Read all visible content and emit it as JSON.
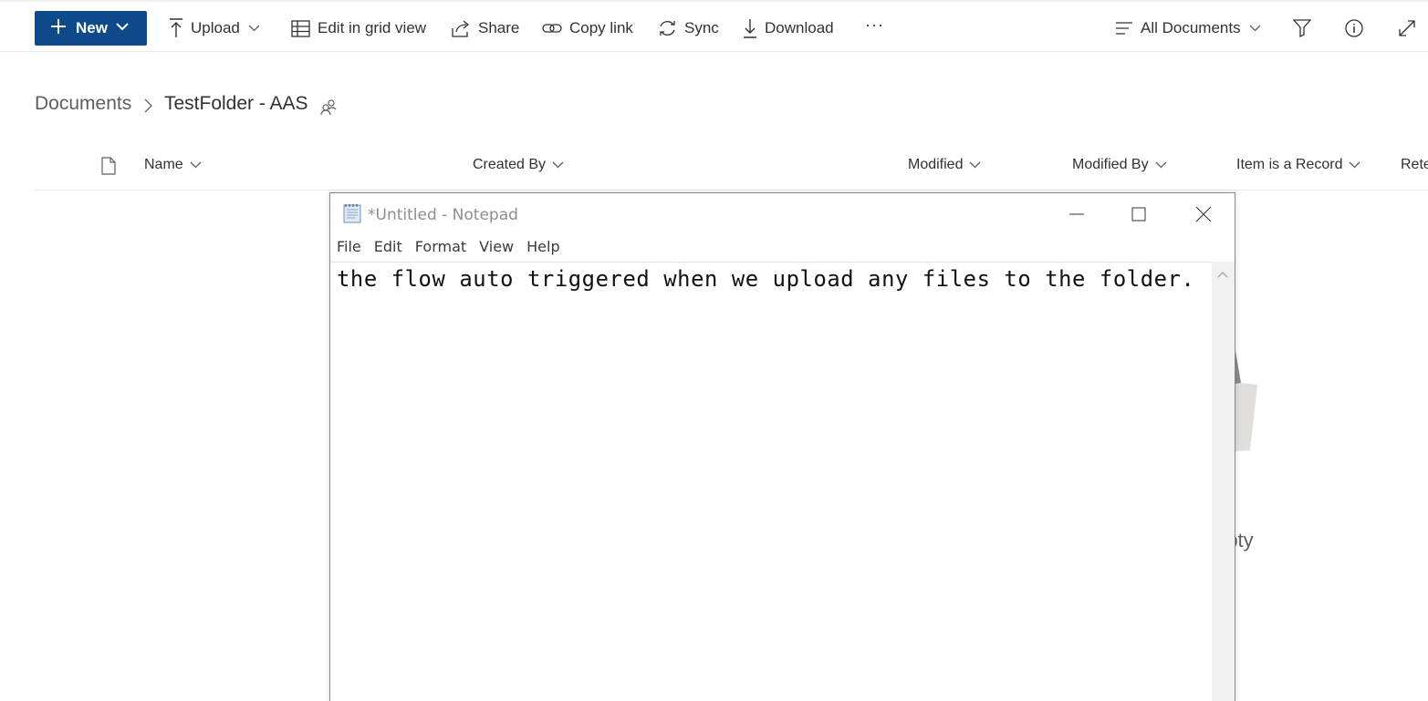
{
  "toolbar": {
    "new_label": "New",
    "upload_label": "Upload",
    "grid_label": "Edit in grid view",
    "share_label": "Share",
    "copylink_label": "Copy link",
    "sync_label": "Sync",
    "download_label": "Download",
    "more_label": "···",
    "view_label": "All Documents"
  },
  "breadcrumb": {
    "root": "Documents",
    "current": "TestFolder - AAS"
  },
  "columns": {
    "name": "Name",
    "created_by": "Created By",
    "modified": "Modified",
    "modified_by": "Modified By",
    "record": "Item is a Record",
    "retention": "Rete"
  },
  "empty_state": {
    "text": "mpty"
  },
  "notepad": {
    "title": "*Untitled - Notepad",
    "menu": [
      "File",
      "Edit",
      "Format",
      "View",
      "Help"
    ],
    "content": "the flow auto triggered when we upload any files to the folder."
  },
  "colors": {
    "accent": "#0f4a8a",
    "text": "#323130",
    "muted": "#605e5c"
  }
}
